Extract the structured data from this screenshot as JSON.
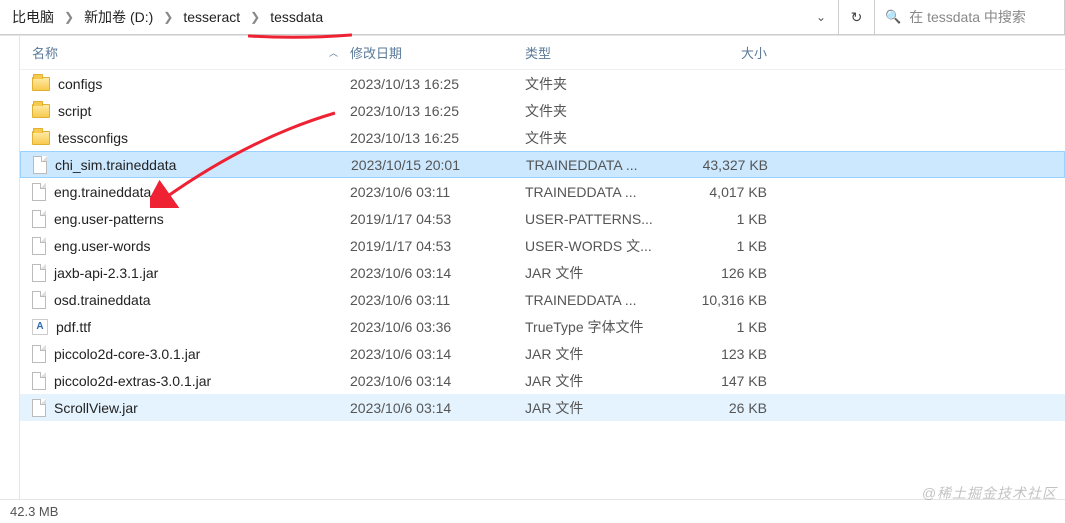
{
  "breadcrumb": {
    "items": [
      "比电脑",
      "新加卷 (D:)",
      "tesseract",
      "tessdata"
    ]
  },
  "search": {
    "placeholder": "在 tessdata 中搜索"
  },
  "columns": {
    "name": "名称",
    "date": "修改日期",
    "type": "类型",
    "size": "大小"
  },
  "files": [
    {
      "icon": "folder",
      "name": "configs",
      "date": "2023/10/13 16:25",
      "type": "文件夹",
      "size": "",
      "state": ""
    },
    {
      "icon": "folder",
      "name": "script",
      "date": "2023/10/13 16:25",
      "type": "文件夹",
      "size": "",
      "state": ""
    },
    {
      "icon": "folder",
      "name": "tessconfigs",
      "date": "2023/10/13 16:25",
      "type": "文件夹",
      "size": "",
      "state": ""
    },
    {
      "icon": "file",
      "name": "chi_sim.traineddata",
      "date": "2023/10/15 20:01",
      "type": "TRAINEDDATA ...",
      "size": "43,327 KB",
      "state": "selected"
    },
    {
      "icon": "file",
      "name": "eng.traineddata",
      "date": "2023/10/6 03:11",
      "type": "TRAINEDDATA ...",
      "size": "4,017 KB",
      "state": ""
    },
    {
      "icon": "file",
      "name": "eng.user-patterns",
      "date": "2019/1/17 04:53",
      "type": "USER-PATTERNS...",
      "size": "1 KB",
      "state": ""
    },
    {
      "icon": "file",
      "name": "eng.user-words",
      "date": "2019/1/17 04:53",
      "type": "USER-WORDS 文...",
      "size": "1 KB",
      "state": ""
    },
    {
      "icon": "file",
      "name": "jaxb-api-2.3.1.jar",
      "date": "2023/10/6 03:14",
      "type": "JAR 文件",
      "size": "126 KB",
      "state": ""
    },
    {
      "icon": "file",
      "name": "osd.traineddata",
      "date": "2023/10/6 03:11",
      "type": "TRAINEDDATA ...",
      "size": "10,316 KB",
      "state": ""
    },
    {
      "icon": "font",
      "name": "pdf.ttf",
      "date": "2023/10/6 03:36",
      "type": "TrueType 字体文件",
      "size": "1 KB",
      "state": ""
    },
    {
      "icon": "file",
      "name": "piccolo2d-core-3.0.1.jar",
      "date": "2023/10/6 03:14",
      "type": "JAR 文件",
      "size": "123 KB",
      "state": ""
    },
    {
      "icon": "file",
      "name": "piccolo2d-extras-3.0.1.jar",
      "date": "2023/10/6 03:14",
      "type": "JAR 文件",
      "size": "147 KB",
      "state": ""
    },
    {
      "icon": "file",
      "name": "ScrollView.jar",
      "date": "2023/10/6 03:14",
      "type": "JAR 文件",
      "size": "26 KB",
      "state": "hover-alt"
    }
  ],
  "status": {
    "text": "42.3 MB"
  },
  "watermark": "@稀土掘金技术社区"
}
